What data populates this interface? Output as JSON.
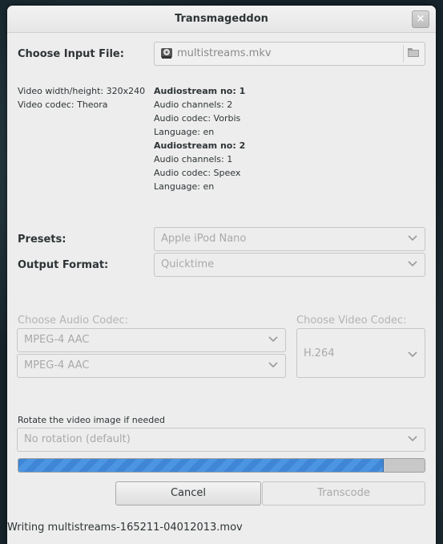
{
  "window": {
    "title": "Transmageddon",
    "close_glyph": "×"
  },
  "input": {
    "label": "Choose Input File:",
    "filename": "multistreams.mkv",
    "file_icon": "film-reel-icon",
    "browse_icon": "folder-icon"
  },
  "video_info": {
    "dimensions": "Video width/height: 320x240",
    "codec": "Video codec: Theora"
  },
  "audio_streams": [
    {
      "header": "Audiostream no: 1",
      "channels": "Audio channels: 2",
      "codec": "Audio codec: Vorbis",
      "language": "Language: en"
    },
    {
      "header": "Audiostream no: 2",
      "channels": "Audio channels: 1",
      "codec": "Audio codec: Speex",
      "language": "Language: en"
    }
  ],
  "presets": {
    "label": "Presets:",
    "value": "Apple iPod Nano"
  },
  "output_format": {
    "label": "Output Format:",
    "value": "Quicktime"
  },
  "audio_codec": {
    "label": "Choose Audio Codec:",
    "values": [
      "MPEG-4 AAC",
      "MPEG-4 AAC"
    ]
  },
  "video_codec": {
    "label": "Choose Video Codec:",
    "value": "H.264"
  },
  "rotation": {
    "label": "Rotate the video image if needed",
    "value": "No rotation (default)"
  },
  "progress": {
    "fraction": 0.9
  },
  "buttons": {
    "cancel": "Cancel",
    "transcode": "Transcode"
  },
  "status": "Writing multistreams-165211-04012013.mov",
  "colors": {
    "progress": "#3f86d6",
    "window_bg": "#ededed"
  }
}
